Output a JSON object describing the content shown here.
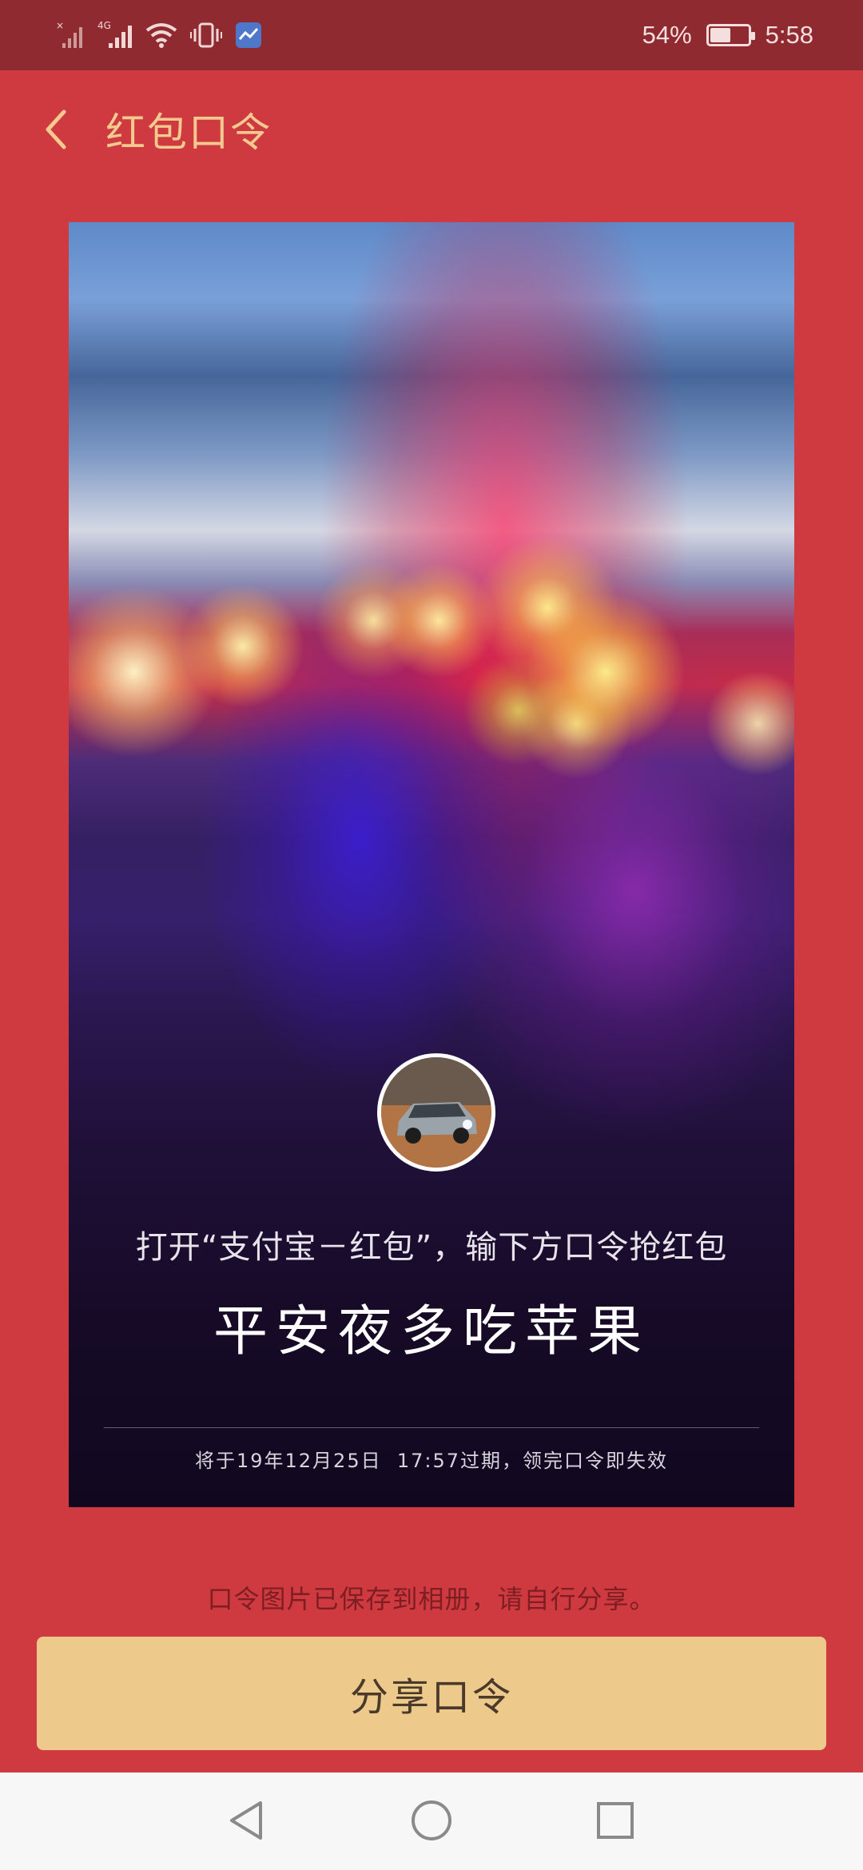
{
  "status_bar": {
    "battery_text": "54%",
    "battery_level": 0.54,
    "time": "5:58",
    "icons": [
      "no-signal-icon",
      "signal-4g-icon",
      "wifi-icon",
      "vibrate-icon",
      "notification-app-icon",
      "battery-icon"
    ]
  },
  "header": {
    "back_icon": "chevron-left-icon",
    "title": "红包口令"
  },
  "poster": {
    "instruction": "打开“支付宝－红包”，输下方口令抢红包",
    "code": "平安夜多吃苹果",
    "expiry": "将于19年12月25日  17:57过期，领完口令即失效"
  },
  "saved_hint": "口令图片已保存到相册，请自行分享。",
  "share_button_label": "分享口令",
  "nav_bar": {
    "icons": [
      "back-triangle-icon",
      "home-circle-icon",
      "recents-square-icon"
    ]
  },
  "colors": {
    "background": "#cf3a40",
    "status_bar": "#8f2a30",
    "title": "#f2c98f",
    "share_button": "#edc98c"
  }
}
